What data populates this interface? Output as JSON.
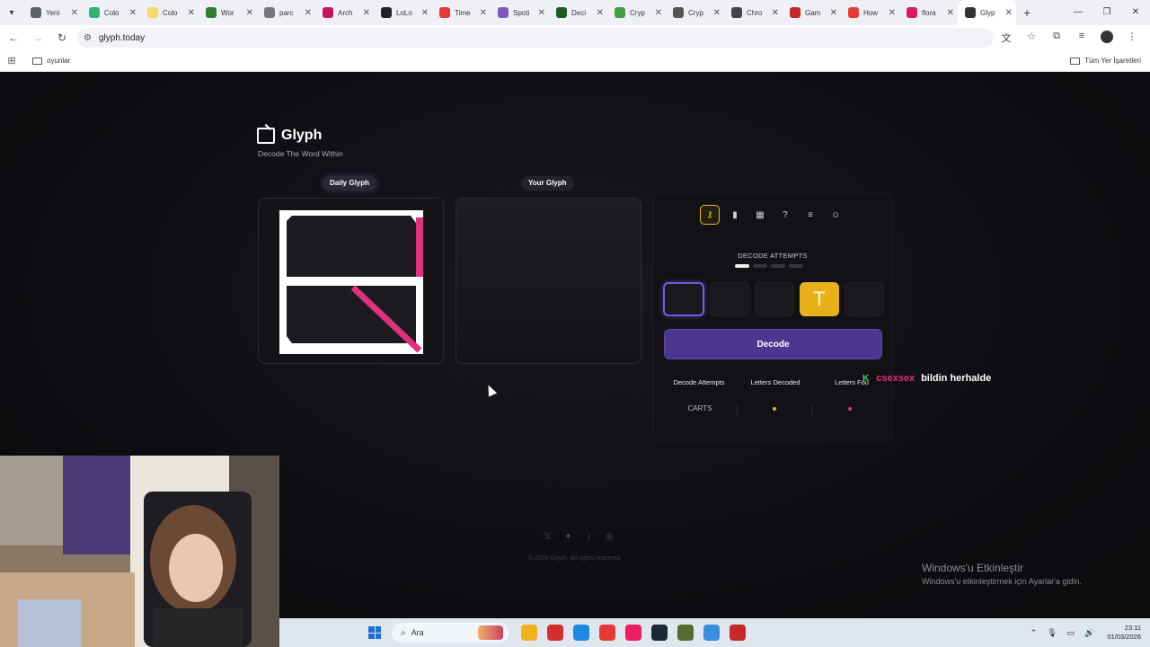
{
  "browser": {
    "tabs": [
      {
        "label": "Yeni",
        "color": "#5f6368"
      },
      {
        "label": "Colo",
        "color": "#2bb673"
      },
      {
        "label": "Colo",
        "color": "#f5d76e"
      },
      {
        "label": "Wor",
        "color": "#2e7d32"
      },
      {
        "label": "parc",
        "color": "#777777"
      },
      {
        "label": "Arch",
        "color": "#c2185b"
      },
      {
        "label": "LoLo",
        "color": "#222222"
      },
      {
        "label": "Time",
        "color": "#e53935"
      },
      {
        "label": "Spoti",
        "color": "#7e57c2"
      },
      {
        "label": "Deci",
        "color": "#1b5e20"
      },
      {
        "label": "Cryp",
        "color": "#43a047"
      },
      {
        "label": "Cryp",
        "color": "#555555"
      },
      {
        "label": "Chro",
        "color": "#444444"
      },
      {
        "label": "Gam",
        "color": "#c62828"
      },
      {
        "label": "How",
        "color": "#e53935"
      },
      {
        "label": "flora",
        "color": "#d81b60"
      },
      {
        "label": "Glyp",
        "color": "#333333",
        "active": true
      }
    ],
    "url": "glyph.today",
    "bookmark_folder": "oyunlar",
    "all_bookmarks": "Tüm Yer İşaretleri"
  },
  "header": {
    "title": "Glyph",
    "tagline": "Decode The Word Within"
  },
  "cards": {
    "daily_label": "Daily Glyph",
    "yours_label": "Your Glyph"
  },
  "panel": {
    "attempts_label": "DECODE ATTEMPTS",
    "attempts_total": 4,
    "attempts_used": 1,
    "slots": [
      "",
      "",
      "",
      "T",
      ""
    ],
    "decode_button": "Decode",
    "stats_headers": [
      "Decode Attempts",
      "Letters Decoded",
      "Letters Fou"
    ],
    "stats_row_label": "CARTS"
  },
  "overlay": {
    "k": "K",
    "user": "csexsex",
    "message": "bildin herhalde"
  },
  "footer": {
    "copyright": "© 2026 Glyph. All rights reserved."
  },
  "activation": {
    "heading": "Windows'u Etkinleştir",
    "subtext": "Windows'u etkinleştirmek için Ayarlar'a gidin."
  },
  "taskbar": {
    "search_placeholder": "Ara",
    "time": "23:11",
    "date": "01/03/2026",
    "apps": [
      "#f2b01e",
      "#d32f2f",
      "#1e88e5",
      "#e53935",
      "#e91e63",
      "#1b2838",
      "#556b2f",
      "#3c8dde",
      "#c62828"
    ]
  },
  "colors": {
    "accent_purple": "#4b3790",
    "gold": "#e8b11a",
    "magenta": "#e0307e"
  }
}
